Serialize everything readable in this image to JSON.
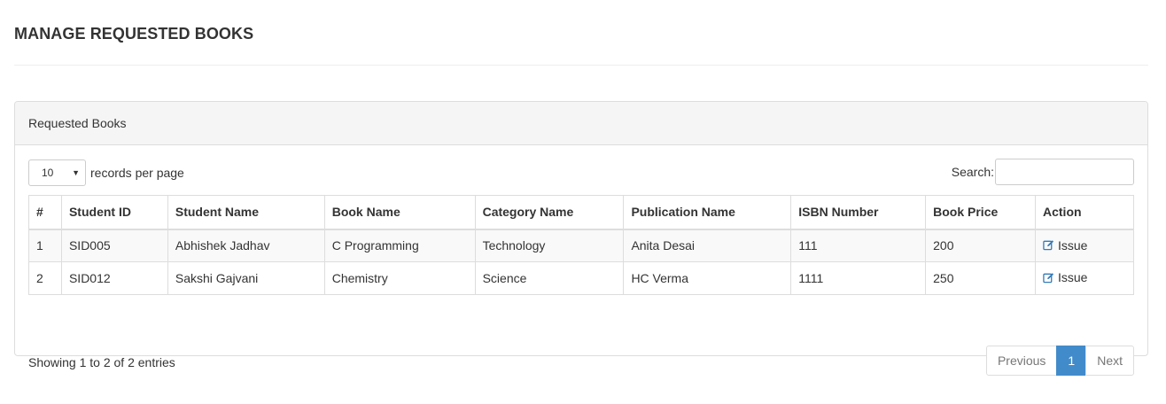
{
  "page": {
    "title": "MANAGE REQUESTED BOOKS"
  },
  "panel": {
    "heading": "Requested Books"
  },
  "length": {
    "value": "10",
    "label": "records per page"
  },
  "search": {
    "label": "Search:",
    "value": "",
    "placeholder": ""
  },
  "table": {
    "headers": [
      "#",
      "Student ID",
      "Student Name",
      "Book Name",
      "Category Name",
      "Publication Name",
      "ISBN Number",
      "Book Price",
      "Action"
    ],
    "rows": [
      {
        "num": "1",
        "student_id": "SID005",
        "student_name": "Abhishek Jadhav",
        "book_name": "C Programming",
        "category": "Technology",
        "publication": "Anita Desai",
        "isbn": "111",
        "price": "200",
        "action": "Issue"
      },
      {
        "num": "2",
        "student_id": "SID012",
        "student_name": "Sakshi Gajvani",
        "book_name": "Chemistry",
        "category": "Science",
        "publication": "HC Verma",
        "isbn": "1111",
        "price": "250",
        "action": "Issue"
      }
    ]
  },
  "info": "Showing 1 to 2 of 2 entries",
  "pagination": {
    "previous": "Previous",
    "current": "1",
    "next": "Next"
  },
  "colors": {
    "accent": "#428bca",
    "link": "#337ab7"
  },
  "icons": {
    "action": "edit-icon",
    "select": "chevron-down-icon"
  }
}
